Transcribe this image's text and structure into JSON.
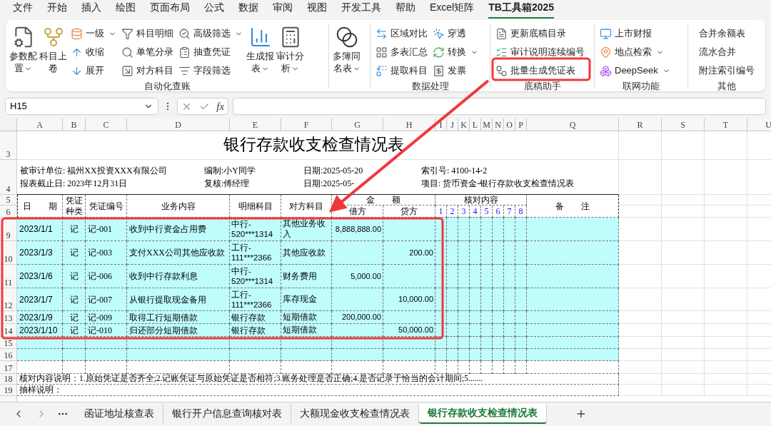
{
  "menu_tabs": [
    {
      "label": "文件",
      "selected": false
    },
    {
      "label": "开始",
      "selected": false
    },
    {
      "label": "插入",
      "selected": false
    },
    {
      "label": "绘图",
      "selected": false
    },
    {
      "label": "页面布局",
      "selected": false
    },
    {
      "label": "公式",
      "selected": false
    },
    {
      "label": "数据",
      "selected": false
    },
    {
      "label": "审阅",
      "selected": false
    },
    {
      "label": "视图",
      "selected": false
    },
    {
      "label": "开发工具",
      "selected": false
    },
    {
      "label": "帮助",
      "selected": false
    },
    {
      "label": "Excel矩阵",
      "selected": false
    },
    {
      "label": "TB工具箱2025",
      "selected": true
    }
  ],
  "ribbon_groups": [
    {
      "label": "自动化查账",
      "columns": [
        {
          "kind": "large",
          "items": [
            {
              "label": "参数配置",
              "dropdown": true
            }
          ]
        },
        {
          "kind": "large",
          "items": [
            {
              "label": "科目上卷",
              "dropdown": false
            }
          ]
        },
        {
          "kind": "small",
          "items": [
            {
              "label": "一级",
              "dropdown": true
            },
            {
              "label": "收缩",
              "dropdown": false
            },
            {
              "label": "展开",
              "dropdown": false
            }
          ]
        },
        {
          "kind": "small",
          "items": [
            {
              "label": "科目明细",
              "dropdown": false
            },
            {
              "label": "单笔分录",
              "dropdown": false
            },
            {
              "label": "对方科目",
              "dropdown": false
            }
          ]
        },
        {
          "kind": "small",
          "items": [
            {
              "label": "高级筛选",
              "dropdown": true
            },
            {
              "label": "抽查凭证",
              "dropdown": false
            },
            {
              "label": "字段筛选",
              "dropdown": false
            }
          ]
        },
        {
          "kind": "large",
          "items": [
            {
              "label": "生成报表",
              "dropdown": true
            }
          ]
        },
        {
          "kind": "large",
          "items": [
            {
              "label": "审计分析",
              "dropdown": true
            }
          ]
        }
      ]
    },
    {
      "columns": [
        {
          "kind": "large",
          "items": [
            {
              "label": "多簿同名表",
              "dropdown": true
            }
          ]
        }
      ]
    },
    {
      "label": "数据处理",
      "columns": [
        {
          "kind": "small",
          "items": [
            {
              "label": "区域对比",
              "dropdown": false
            },
            {
              "label": "多表汇总",
              "dropdown": false
            },
            {
              "label": "提取科目",
              "dropdown": false
            }
          ]
        },
        {
          "kind": "small",
          "items": [
            {
              "label": "穿透",
              "dropdown": false
            },
            {
              "label": "转换",
              "dropdown": true
            },
            {
              "label": "发票",
              "dropdown": false
            }
          ]
        }
      ]
    },
    {
      "label": "底稿助手",
      "columns": [
        {
          "kind": "small",
          "items": [
            {
              "label": "更新底稿目录",
              "dropdown": false
            },
            {
              "label": "审计说明连续编号",
              "dropdown": false
            },
            {
              "label": "批量生成凭证表",
              "dropdown": false
            }
          ]
        }
      ]
    },
    {
      "label": "联网功能",
      "columns": [
        {
          "kind": "small",
          "items": [
            {
              "label": "上市财报",
              "dropdown": false
            },
            {
              "label": "地点检索",
              "dropdown": true
            },
            {
              "label": "DeepSeek",
              "dropdown": true
            }
          ]
        }
      ]
    },
    {
      "label": "其他",
      "columns": [
        {
          "kind": "small",
          "items": [
            {
              "label": "合并余额表",
              "dropdown": false
            },
            {
              "label": "流水合并",
              "dropdown": false
            },
            {
              "label": "附注索引编号",
              "dropdown": false
            }
          ]
        }
      ]
    }
  ],
  "formula_bar": {
    "name_box": "H15",
    "function_label": "fx"
  },
  "sheet": {
    "column_letters": [
      "A",
      "B",
      "C",
      "D",
      "E",
      "F",
      "G",
      "H",
      "I",
      "J",
      "K",
      "L",
      "M",
      "N",
      "O",
      "P",
      "Q",
      "R",
      "S",
      "T",
      "U"
    ],
    "title_row": "3",
    "title": "银行存款收支检查情况表",
    "info_row": "4",
    "info": [
      [
        "被审计单位: 福州XX投资XXX有限公司",
        "编制:小Y同学",
        "日期:2025-05-20",
        "索引号: 4100-14-2"
      ],
      [
        "报表截止日: 2023年12月31日",
        "复核:傅经理",
        "日期:2025-05-",
        "项目: 货币资金-银行存款收支检查情况表"
      ]
    ],
    "header_rows": [
      "5",
      "6"
    ],
    "header": {
      "date": "日　　期",
      "voucher_type": "凭证种类",
      "voucher_no": "凭证编号",
      "description": "业务内容",
      "detail_account": "明细科目",
      "counter_account": "对方科目",
      "amount": "金　　额",
      "debit": "借方",
      "credit": "贷方",
      "check": "核对内容",
      "check_items": [
        "1",
        "2",
        "3",
        "4",
        "5",
        "6",
        "7",
        "8"
      ],
      "remarks": "备　　注"
    },
    "rows": [
      {
        "row": "9",
        "highlighted": true,
        "date": "2023/1/1",
        "type": "记",
        "voucher_no": "记-001",
        "description": "收到中行资金占用费",
        "detail_account": "中行-520***1314",
        "counter_account": "其他业务收入",
        "debit": "8,888,888.00"
      },
      {
        "row": "10",
        "highlighted": true,
        "date": "2023/1/3",
        "type": "记",
        "voucher_no": "记-003",
        "description": "支付XXX公司其他应收款",
        "detail_account": "工行-111***2366",
        "counter_account": "其他应收款",
        "credit": "200.00"
      },
      {
        "row": "11",
        "highlighted": true,
        "date": "2023/1/6",
        "type": "记",
        "voucher_no": "记-006",
        "description": "收到中行存款利息",
        "detail_account": "中行-520***1314",
        "counter_account": "财务费用",
        "debit": "5,000.00"
      },
      {
        "row": "12",
        "highlighted": true,
        "date": "2023/1/7",
        "type": "记",
        "voucher_no": "记-007",
        "description": "从银行提取现金备用",
        "detail_account": "工行-111***2366",
        "counter_account": "库存现金",
        "credit": "10,000.00"
      },
      {
        "row": "13",
        "highlighted": true,
        "date": "2023/1/9",
        "type": "记",
        "voucher_no": "记-009",
        "description": "取得工行短期借款",
        "detail_account": "银行存款",
        "counter_account": "短期借款",
        "debit": "200,000.00"
      },
      {
        "row": "14",
        "highlighted": true,
        "date": "2023/1/10",
        "type": "记",
        "voucher_no": "记-010",
        "description": "归还部分短期借款",
        "detail_account": "银行存款",
        "counter_account": "短期借款",
        "credit": "50,000.00"
      }
    ],
    "blank_rows": [
      {
        "row": "15",
        "highlighted": true
      },
      {
        "row": "16",
        "highlighted": true
      },
      {
        "row": "17",
        "highlighted": false
      }
    ],
    "notes": [
      {
        "row": "18",
        "text": "核对内容说明：1.原始凭证是否齐全;2.记账凭证与原始凭证是否相符;3.账务处理是否正确;4.是否记录于恰当的会计期间;5......."
      },
      {
        "row": "19",
        "text": "抽样说明："
      }
    ]
  },
  "sheet_tabs": [
    {
      "label": "函证地址核查表",
      "selected": false
    },
    {
      "label": "银行开户信息查询核对表",
      "selected": false
    },
    {
      "label": "大额现金收支检查情况表",
      "selected": false
    },
    {
      "label": "银行存款收支检查情况表",
      "selected": true
    }
  ]
}
